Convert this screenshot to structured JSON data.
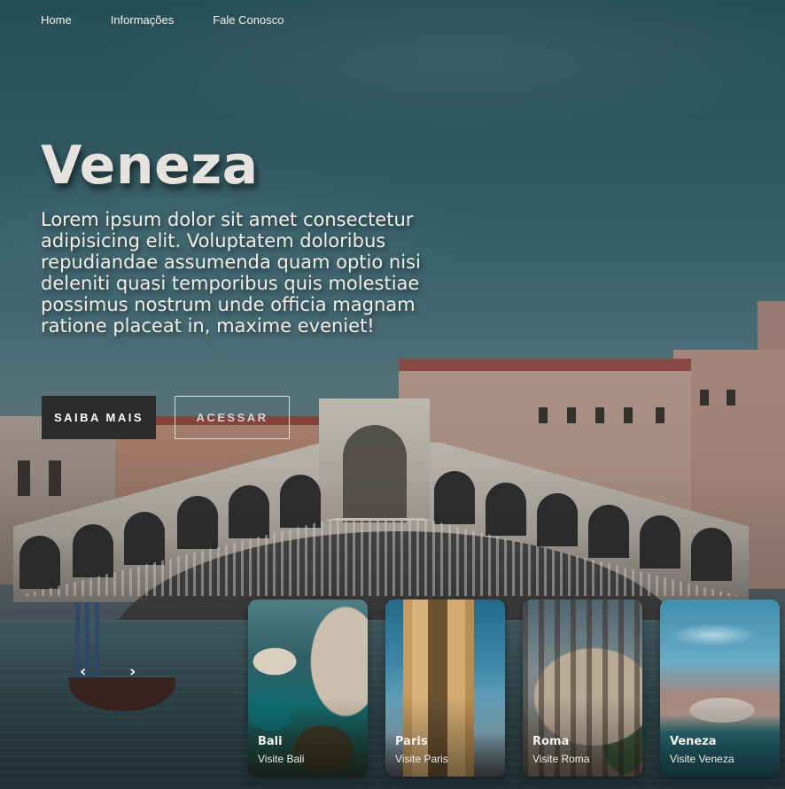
{
  "nav": {
    "items": [
      {
        "label": "Home"
      },
      {
        "label": "Informações"
      },
      {
        "label": "Fale Conosco"
      }
    ]
  },
  "hero": {
    "title": "Veneza",
    "text": "Lorem ipsum dolor sit amet consectetur adipisicing elit. Voluptatem doloribus repudiandae assumenda quam optio nisi deleniti quasi temporibus quis molestiae possimus nostrum unde officia magnam ratione placeat in, maxime eveniet!",
    "primary_button": "SAIBA MAIS",
    "secondary_button": "ACESSAR"
  },
  "carousel": {
    "prev_icon": "chevron-left-icon",
    "prev_glyph": "‹",
    "next_icon": "chevron-right-icon",
    "next_glyph": "›",
    "cards": [
      {
        "title": "Bali",
        "subtitle": "Visite Bali"
      },
      {
        "title": "Paris",
        "subtitle": "Visite Paris"
      },
      {
        "title": "Roma",
        "subtitle": "Visite Roma"
      },
      {
        "title": "Veneza",
        "subtitle": "Visite Veneza"
      }
    ]
  },
  "colors": {
    "primary_button_bg": "#2b2b2c",
    "title_color": "#e6e2de",
    "secondary_border": "#d9dcdc"
  }
}
